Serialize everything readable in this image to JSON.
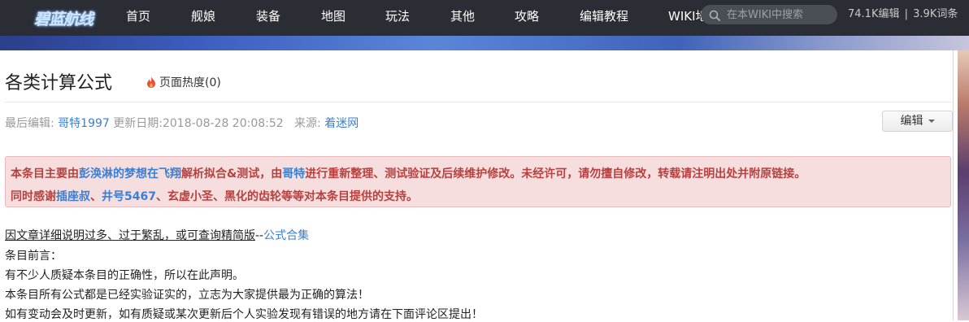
{
  "header": {
    "logo_text": "碧蓝航线",
    "nav": [
      "首页",
      "舰娘",
      "装备",
      "地图",
      "玩法",
      "其他",
      "攻略",
      "编辑教程",
      "WIKI地图"
    ],
    "search_placeholder": "在本WIKI中搜索",
    "stats_edits": "74.1K编辑",
    "stats_sep": "|",
    "stats_entries": "3.9K词条"
  },
  "page": {
    "title": "各类计算公式",
    "heat_label": "页面热度(0)",
    "meta": {
      "last_editor_label": "最后编辑:",
      "last_editor": "哥特1997",
      "update_label": "更新日期:",
      "update_date": "2018-08-28 20:08:52",
      "source_label": "来源:",
      "source": "着迷网"
    },
    "edit_button": "编辑"
  },
  "notice": {
    "l1_a": "本条目主要由",
    "l1_link1": "彭涣淋的梦想在飞翔",
    "l1_b": "解析拟合&测试，由",
    "l1_link2": "哥特",
    "l1_c": "进行重新整理、测试验证及后续维护修改。未经许可，请勿擅自修改，转载请注明出处并附原链接。",
    "l2_a": "同时感谢",
    "l2_link1": "插座叔",
    "l2_b": "、",
    "l2_link2": "井号5467",
    "l2_c": "、玄虚小圣、黑化的齿轮等等对本条目提供的支持。"
  },
  "body": {
    "line1_text": "因文章详细说明过多、过于繁乱，或可查询精简版",
    "line1_dash": "--",
    "line1_link": "公式合集",
    "line2": "条目前言：",
    "line3": "有不少人质疑本条目的正确性，所以在此声明。",
    "line4": "本条目所有公式都是已经实验证实的，立志为大家提供最为正确的算法！",
    "line5": "如有变动会及时更新，如有质疑或某次更新后个人实验发现有错误的地方请在下面评论区提出！"
  },
  "colors": {
    "topbar": "#2a2d33",
    "link": "#3a7fd6",
    "notice_bg": "#f6dedf",
    "notice_text": "#b8413f"
  },
  "icons": [
    "search-icon",
    "fire-icon",
    "chevron-down-icon"
  ]
}
